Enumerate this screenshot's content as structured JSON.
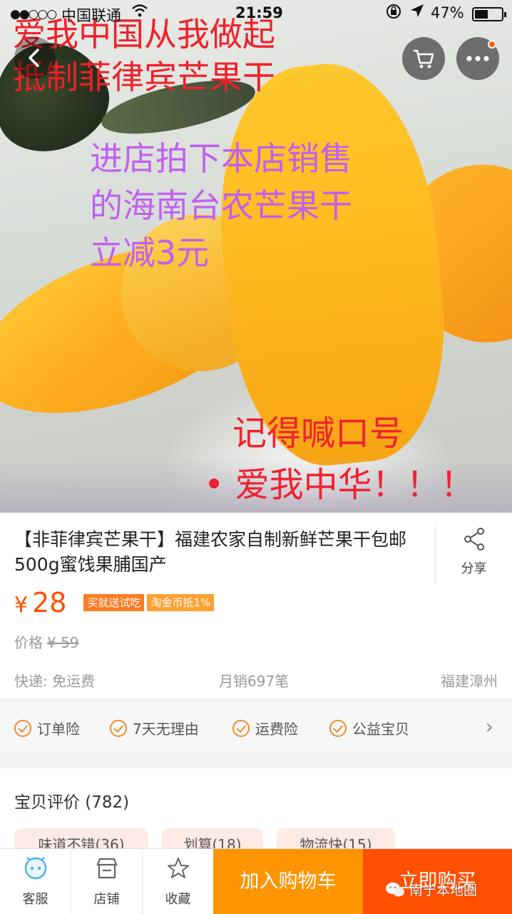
{
  "status_bar": {
    "signal": "●●○○○",
    "carrier": "中国联通",
    "time": "21:59",
    "battery_pct": "47%"
  },
  "hero": {
    "slogan_line1": "爱我中国从我做起",
    "slogan_line2": "抵制菲律宾芒果干",
    "promo_line1": "进店拍下本店销售",
    "promo_line2": "的海南台农芒果干",
    "promo_line3": "立减3元",
    "remember": "记得喊口号",
    "shout": "• 爱我中华！！！",
    "icons": [
      "back-icon",
      "cart-icon",
      "more-icon"
    ]
  },
  "product": {
    "title": "【非菲律宾芒果干】福建农家自制新鲜芒果干包邮500g蜜饯果脯国产",
    "share_label": "分享",
    "currency": "¥",
    "price": "28",
    "badges": [
      "买就送试吃",
      "淘金币抵1%"
    ],
    "orig_price_label": "价格",
    "orig_price": "¥ 59",
    "shipping": "快递: 免运费",
    "monthly_sales": "月销697笔",
    "location": "福建漳州"
  },
  "guarantees": [
    "订单险",
    "7天无理由",
    "运费险",
    "公益宝贝"
  ],
  "reviews": {
    "title": "宝贝评价 (782)",
    "tags": [
      "味道不错(36)",
      "划算(18)",
      "物流快(15)"
    ]
  },
  "bottom_bar": {
    "service": "客服",
    "shop": "店铺",
    "favorite": "收藏",
    "add_to_cart": "加入购物车",
    "buy_now": "立即购买"
  },
  "watermark": "南宁本地圈",
  "colors": {
    "accent": "#ff5000",
    "cart_button": "#ff9402",
    "overlay_red": "#f0202a",
    "overlay_purple": "#c060f0"
  }
}
